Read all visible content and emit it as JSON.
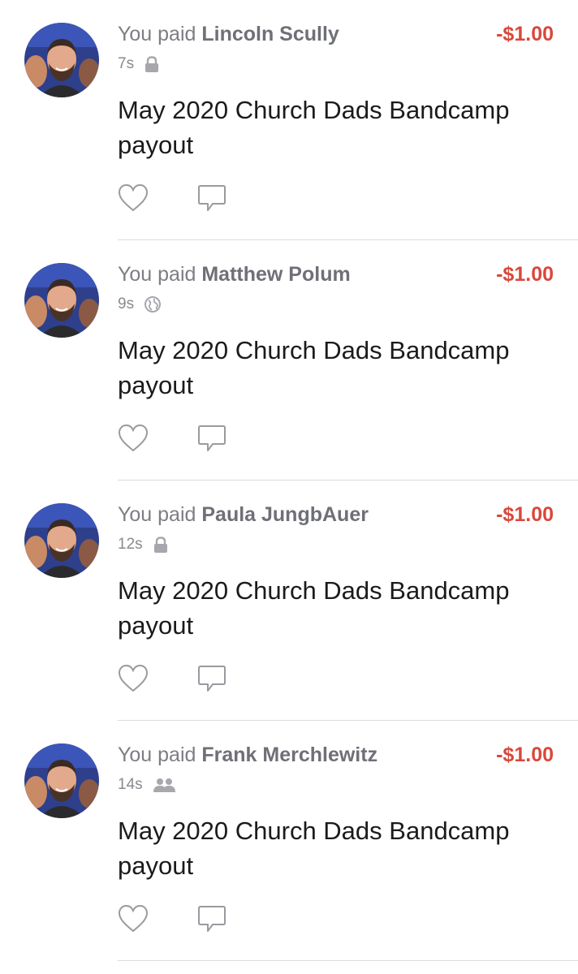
{
  "transactions": [
    {
      "prefix": "You paid",
      "payee": "Lincoln Scully",
      "amount": "-$1.00",
      "time": "7s",
      "privacy_icon": "lock-icon",
      "note": "May 2020 Church Dads Bandcamp payout"
    },
    {
      "prefix": "You paid",
      "payee": "Matthew Polum",
      "amount": "-$1.00",
      "time": "9s",
      "privacy_icon": "globe-icon",
      "note": "May 2020 Church Dads Bandcamp payout"
    },
    {
      "prefix": "You paid",
      "payee": "Paula JungbAuer",
      "amount": "-$1.00",
      "time": "12s",
      "privacy_icon": "lock-icon",
      "note": "May 2020 Church Dads Bandcamp payout"
    },
    {
      "prefix": "You paid",
      "payee": "Frank Merchlewitz",
      "amount": "-$1.00",
      "time": "14s",
      "privacy_icon": "friends-icon",
      "note": "May 2020 Church Dads Bandcamp payout"
    }
  ],
  "colors": {
    "amount_negative": "#d9483b",
    "secondary_text": "#7d7d84",
    "icon_gray": "#a7a7ad"
  }
}
